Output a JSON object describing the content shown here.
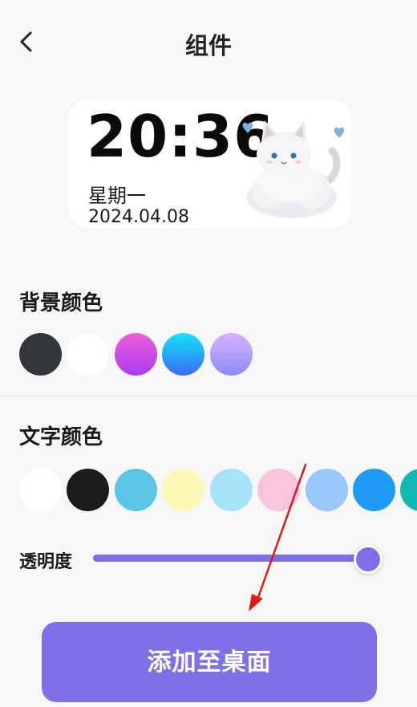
{
  "header": {
    "title": "组件",
    "back_icon": "chevron-left-icon"
  },
  "widget": {
    "time": "20:36",
    "weekday": "星期一",
    "date": "2024.04.08",
    "decoration": "cat-cloud-illustration"
  },
  "background_color": {
    "label": "背景颜色",
    "swatches": [
      {
        "name": "dark-gray",
        "color": "#33373b"
      },
      {
        "name": "white",
        "color": "#ffffff"
      },
      {
        "name": "pink-purple-gradient",
        "color": "#d64bf0"
      },
      {
        "name": "cyan-blue-gradient",
        "color": "#1fb3f5"
      },
      {
        "name": "lavender-gradient",
        "color": "#b6a0ff"
      }
    ]
  },
  "text_color": {
    "label": "文字颜色",
    "swatches": [
      {
        "name": "white",
        "color": "#ffffff"
      },
      {
        "name": "black",
        "color": "#1c1c1c"
      },
      {
        "name": "sky-blue",
        "color": "#5bc5e6"
      },
      {
        "name": "light-yellow",
        "color": "#fbf8b8"
      },
      {
        "name": "light-cyan",
        "color": "#a9e3fb"
      },
      {
        "name": "light-pink",
        "color": "#fbc3dc"
      },
      {
        "name": "periwinkle",
        "color": "#9ac8fb"
      },
      {
        "name": "blue",
        "color": "#1f9bf3"
      },
      {
        "name": "teal",
        "color": "#13b7b3"
      }
    ]
  },
  "opacity": {
    "label": "透明度",
    "value": 0.98
  },
  "actions": {
    "add_to_desktop": "添加至桌面"
  },
  "colors": {
    "accent": "#8070e8",
    "slider": "#7d6fe6",
    "annotation_arrow": "#e01818"
  }
}
